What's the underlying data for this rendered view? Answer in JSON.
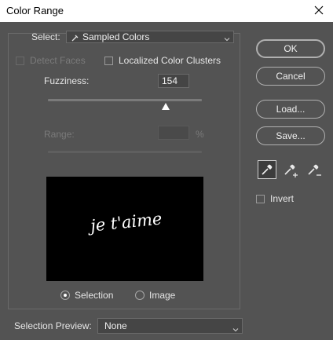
{
  "window": {
    "title": "Color Range"
  },
  "select": {
    "label": "Select:",
    "value": "Sampled Colors"
  },
  "options": {
    "detect_faces": "Detect Faces",
    "localized_clusters": "Localized Color Clusters"
  },
  "fuzziness": {
    "label": "Fuzziness:",
    "value": "154"
  },
  "range": {
    "label": "Range:",
    "value": "",
    "unit": "%"
  },
  "preview": {
    "text": "je t'aime"
  },
  "view": {
    "selection_label": "Selection",
    "image_label": "Image",
    "selected": "Selection"
  },
  "selection_preview": {
    "label": "Selection Preview:",
    "value": "None"
  },
  "buttons": {
    "ok": "OK",
    "cancel": "Cancel",
    "load": "Load...",
    "save": "Save..."
  },
  "invert": {
    "label": "Invert"
  },
  "colors": {
    "background": "#535353",
    "titlebar": "#ffffff",
    "text": "#e6e6e6",
    "disabled_text": "#7a7a7a"
  }
}
